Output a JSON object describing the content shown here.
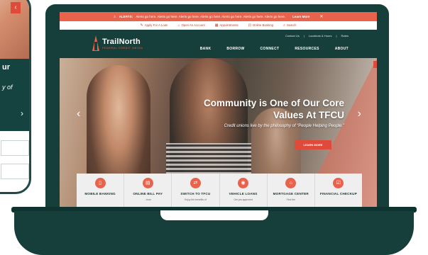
{
  "colors": {
    "brand_dark": "#163f3b",
    "accent": "#e8624c",
    "button": "#e04a3a"
  },
  "phone": {
    "panel_heading": "ur",
    "panel_text": "y of",
    "chevron_right": "›",
    "chevron_left": "‹"
  },
  "alert": {
    "icon": "warning-icon",
    "label": "ALERTS:",
    "text": "Alerts go here. Alerts go here. Alerts go here. Alerts go here. Alerts go here. Alerts go here. Alerts go here.",
    "more": "Learn More",
    "close": "✕"
  },
  "utility": [
    {
      "icon": "pencil-icon",
      "glyph": "✎",
      "label": "Apply For A Loan"
    },
    {
      "icon": "bank-icon",
      "glyph": "⌂",
      "label": "Open An Account"
    },
    {
      "icon": "calendar-icon",
      "glyph": "▦",
      "label": "Appointments"
    },
    {
      "icon": "lock-icon",
      "glyph": "⊡",
      "label": "Online Banking"
    },
    {
      "icon": "search-icon",
      "glyph": "⌕",
      "label": "Search"
    }
  ],
  "logo": {
    "name": "TrailNorth",
    "tagline": "FEDERAL CREDIT UNION"
  },
  "nav_top": [
    "Contact Us",
    "|",
    "Locations & Hours",
    "|",
    "Rates"
  ],
  "nav_main": [
    "BANK",
    "BORROW",
    "CONNECT",
    "RESOURCES",
    "ABOUT"
  ],
  "hero": {
    "title": "Community is One of Our Core Values At TFCU",
    "subtitle": "Credit unions live by the philosophy of “People Helping People.”",
    "button": "LEARN MORE",
    "prev": "‹",
    "next": "›"
  },
  "tiles": [
    {
      "icon": "mobile-icon",
      "glyph": "▯",
      "label": "MOBILE BANKING",
      "desc": ""
    },
    {
      "icon": "bill-icon",
      "glyph": "▤",
      "label": "ONLINE BILL PAY",
      "desc": "...from"
    },
    {
      "icon": "switch-icon",
      "glyph": "⇄",
      "label": "SWITCH TO TFCU",
      "desc": "Enjoy the benefits of"
    },
    {
      "icon": "car-icon",
      "glyph": "◉",
      "label": "VEHICLE LOANS",
      "desc": "Get pre-approved"
    },
    {
      "icon": "house-icon",
      "glyph": "⌂",
      "label": "MORTGAGE CENTER",
      "desc": "Find the"
    },
    {
      "icon": "checklist-icon",
      "glyph": "☑",
      "label": "FINANCIAL CHECKUP",
      "desc": ""
    }
  ]
}
